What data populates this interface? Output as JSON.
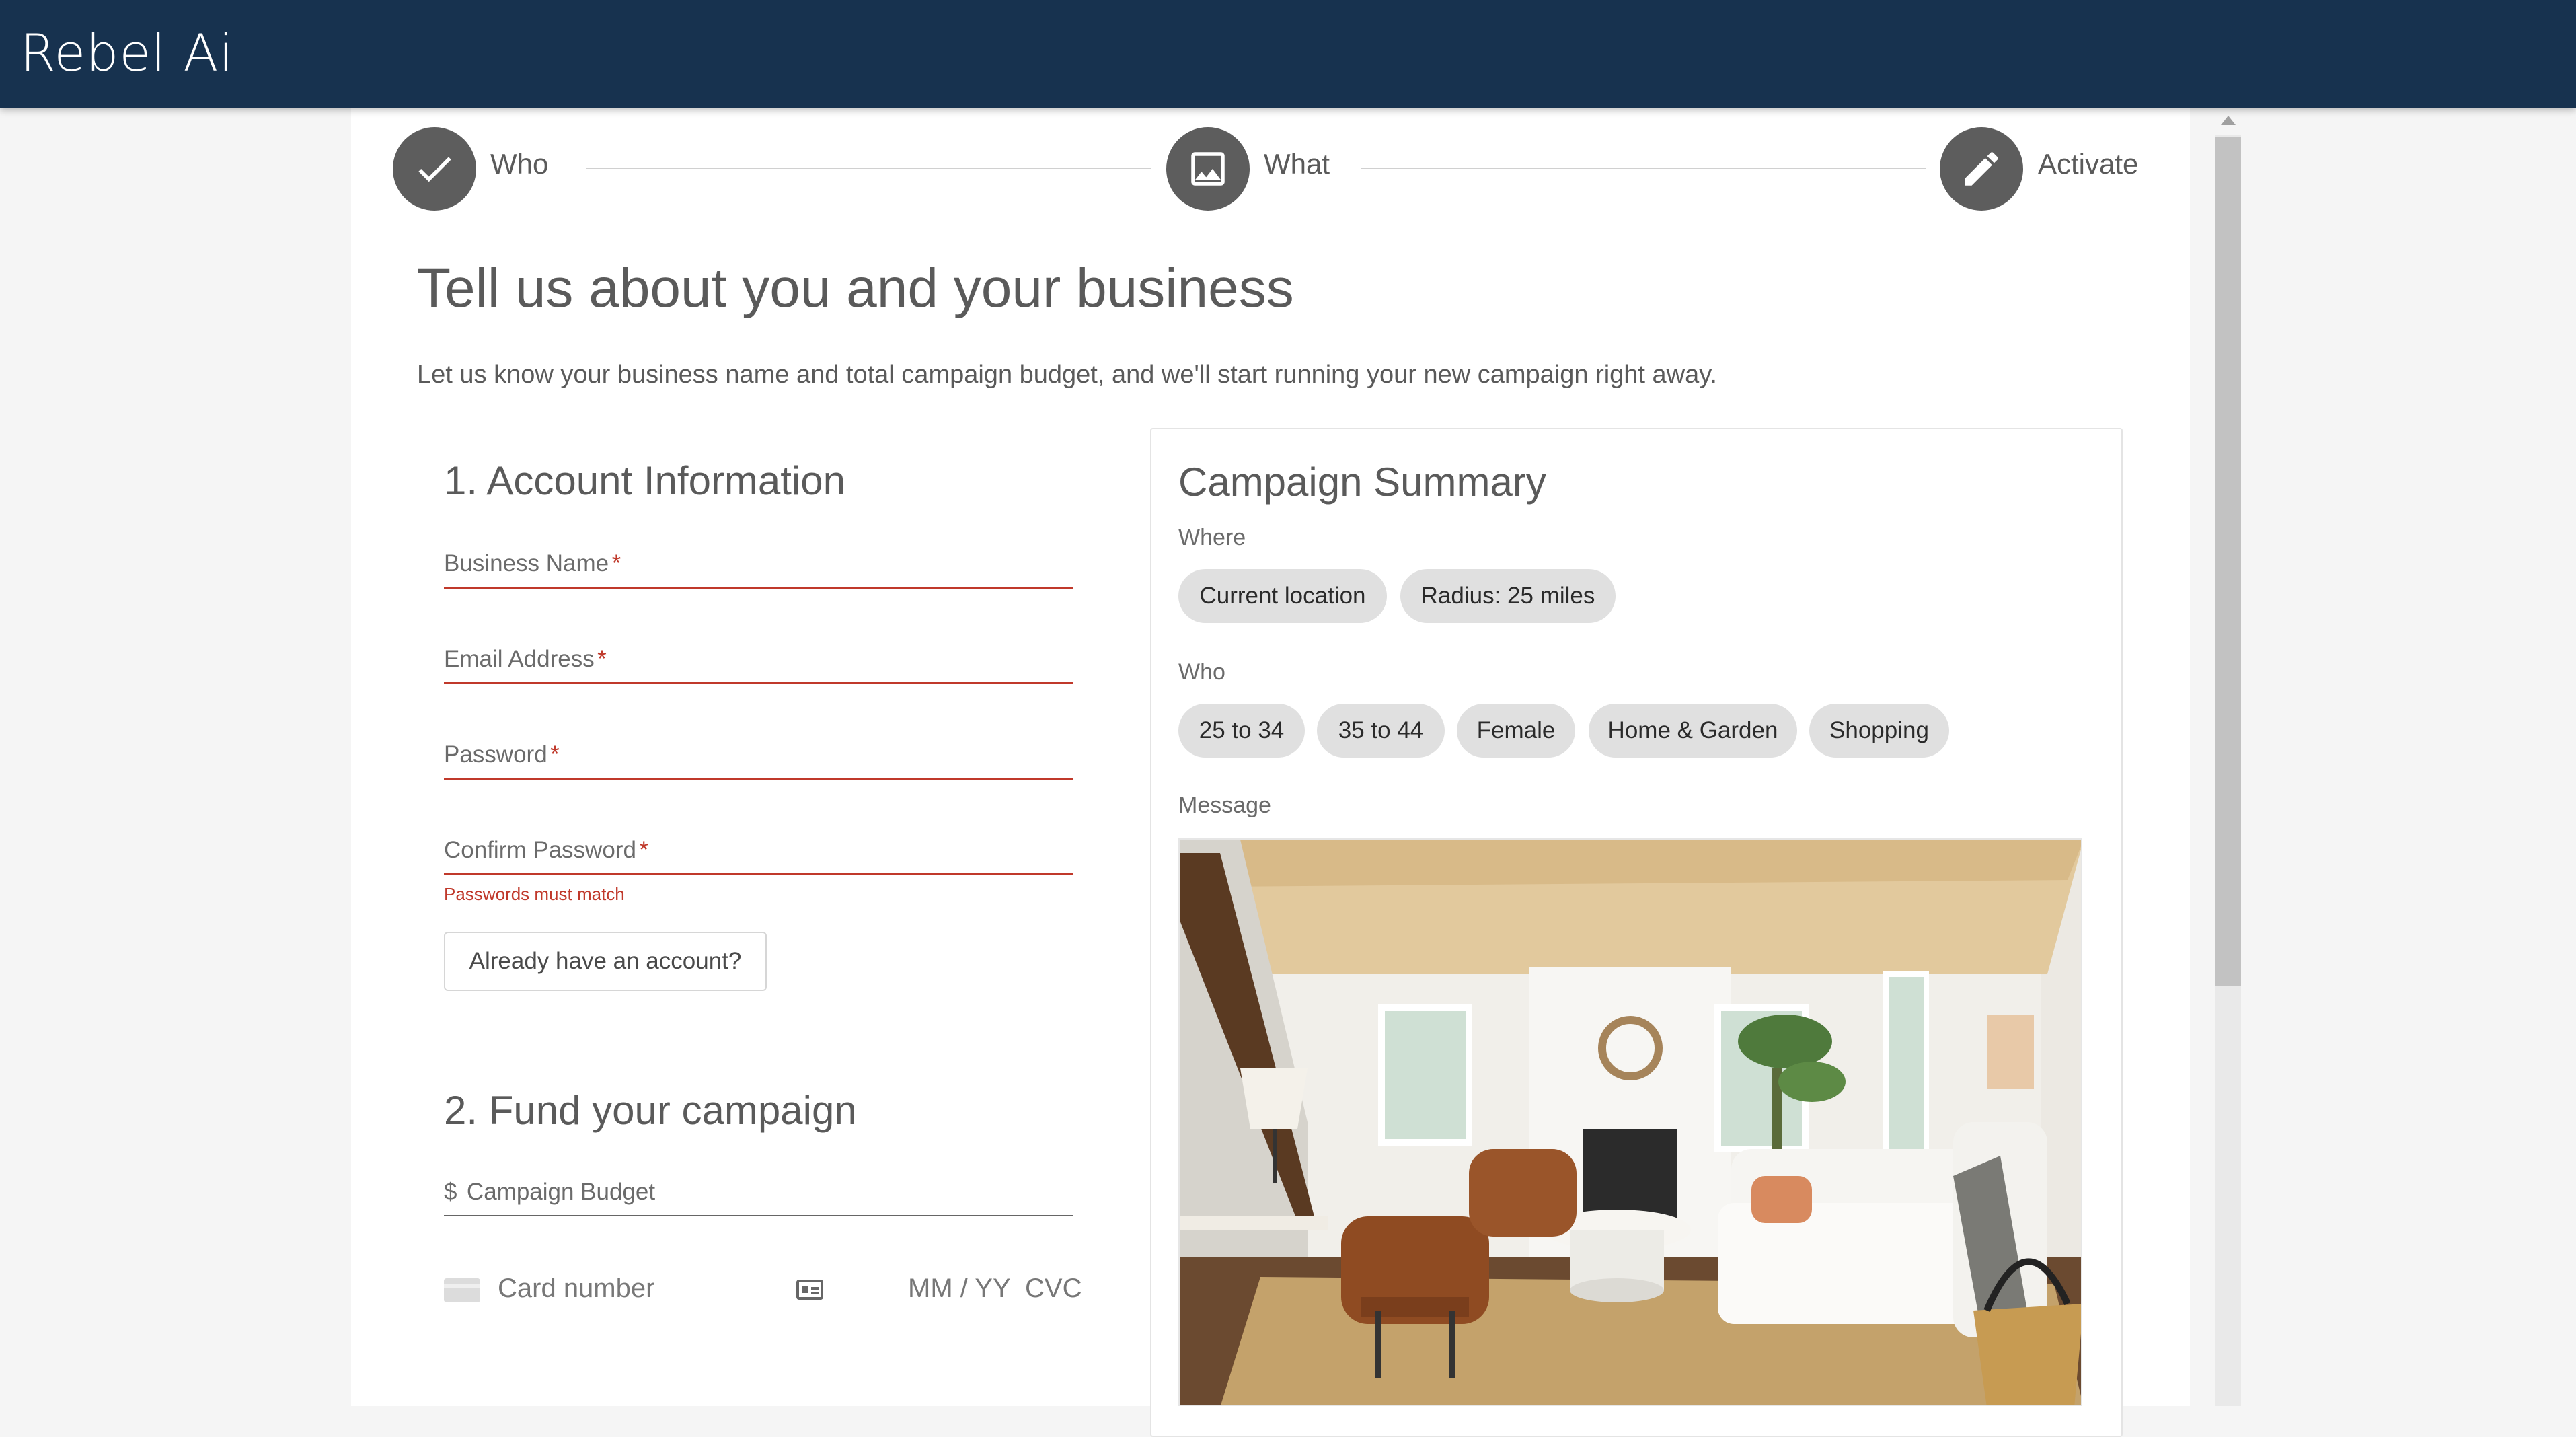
{
  "app": {
    "logo": "Rebel Ai"
  },
  "stepper": {
    "steps": [
      {
        "label": "Who",
        "icon": "check-icon"
      },
      {
        "label": "What",
        "icon": "image-icon"
      },
      {
        "label": "Activate",
        "icon": "pencil-icon"
      }
    ]
  },
  "page": {
    "title": "Tell us about you and your business",
    "subtitle": "Let us know your business name and total campaign budget, and we'll start running your new campaign right away."
  },
  "account": {
    "heading": "1. Account Information",
    "fields": [
      {
        "label": "Business Name",
        "required": "*"
      },
      {
        "label": "Email Address",
        "required": "*"
      },
      {
        "label": "Password",
        "required": "*"
      },
      {
        "label": "Confirm Password",
        "required": "*"
      }
    ],
    "error": "Passwords must match",
    "existing_button": "Already have an account?"
  },
  "fund": {
    "heading": "2. Fund your campaign",
    "currency": "$",
    "budget_placeholder": "Campaign Budget",
    "card_number_placeholder": "Card number",
    "expiry_placeholder": "MM / YY",
    "cvc_placeholder": "CVC"
  },
  "summary": {
    "title": "Campaign Summary",
    "where_label": "Where",
    "where_chips": [
      "Current location",
      "Radius: 25 miles"
    ],
    "who_label": "Who",
    "who_chips": [
      "25 to 34",
      "35 to 44",
      "Female",
      "Home & Garden",
      "Shopping"
    ],
    "message_label": "Message"
  },
  "colors": {
    "header": "#17324f",
    "step_circle": "#5d5d5d",
    "error": "#c0392b",
    "chip": "#e0e0e0"
  }
}
